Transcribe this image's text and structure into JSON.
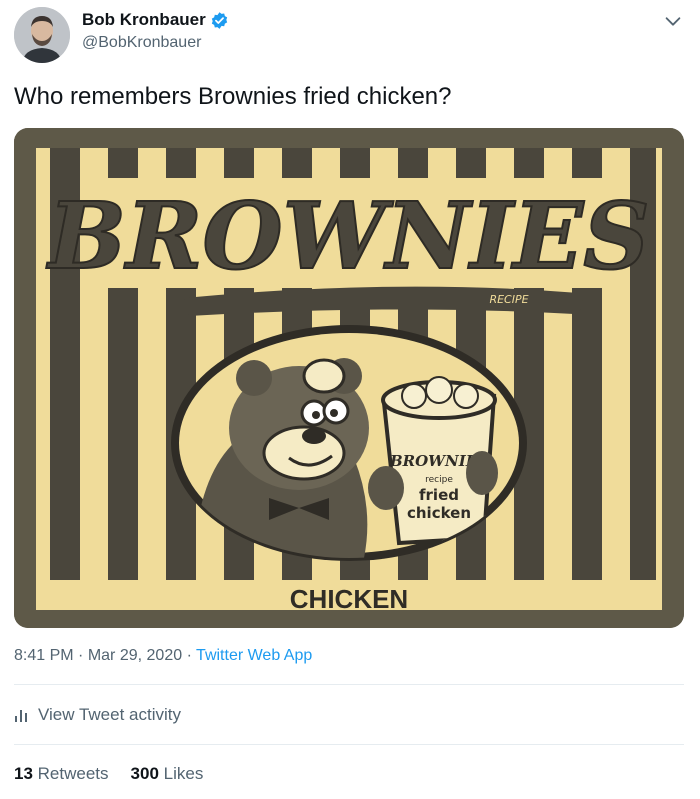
{
  "author": {
    "name": "Bob Kronbauer",
    "handle": "@BobKronbauer",
    "verified_icon": "verified-badge-icon",
    "avatar_icon": "avatar-photo"
  },
  "tweet": {
    "text": "Who remembers Brownies fried chicken?",
    "more_icon": "chevron-down-icon"
  },
  "media": {
    "brand": "BROWNIES",
    "recipe": "RECIPE",
    "bucket_brand": "BROWNIES",
    "bucket_recipe": "recipe",
    "bucket_fried": "fried",
    "bucket_chicken": "chicken",
    "caption": "CHICKEN"
  },
  "meta": {
    "time": "8:41 PM",
    "dot1": "·",
    "date": "Mar 29, 2020",
    "dot2": "·",
    "source": "Twitter Web App"
  },
  "activity": {
    "label": "View Tweet activity",
    "icon": "bar-chart-icon"
  },
  "stats": {
    "retweets_count": "13",
    "retweets_label": "Retweets",
    "likes_count": "300",
    "likes_label": "Likes"
  },
  "colors": {
    "accent": "#1d9bf0",
    "paper": "#f0dc9a",
    "ink": "#4a463c"
  }
}
